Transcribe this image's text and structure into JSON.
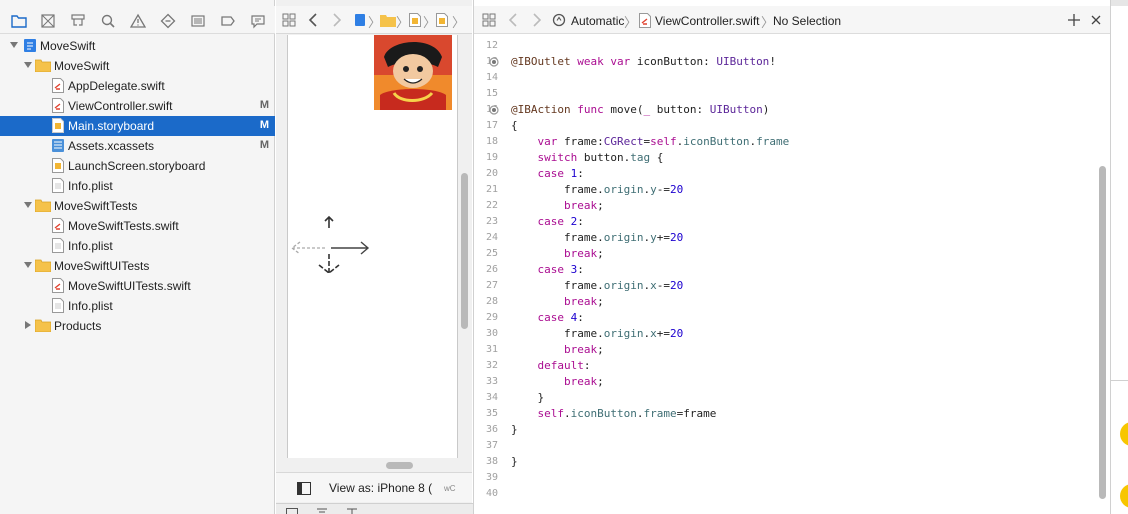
{
  "navigator": {
    "rows": [
      {
        "label": "MoveSwift",
        "badge": ""
      },
      {
        "label": "MoveSwift",
        "badge": ""
      },
      {
        "label": "AppDelegate.swift",
        "badge": ""
      },
      {
        "label": "ViewController.swift",
        "badge": "M"
      },
      {
        "label": "Main.storyboard",
        "badge": "M"
      },
      {
        "label": "Assets.xcassets",
        "badge": "M"
      },
      {
        "label": "LaunchScreen.storyboard",
        "badge": ""
      },
      {
        "label": "Info.plist",
        "badge": ""
      },
      {
        "label": "MoveSwiftTests",
        "badge": ""
      },
      {
        "label": "MoveSwiftTests.swift",
        "badge": ""
      },
      {
        "label": "Info.plist",
        "badge": ""
      },
      {
        "label": "MoveSwiftUITests",
        "badge": ""
      },
      {
        "label": "MoveSwiftUITests.swift",
        "badge": ""
      },
      {
        "label": "Info.plist",
        "badge": ""
      },
      {
        "label": "Products",
        "badge": ""
      }
    ]
  },
  "canvas": {
    "view_as": "View as: iPhone 8 (",
    "size_class": "wC",
    "trailing": "h"
  },
  "editor": {
    "jumpbar": {
      "mode": "Automatic",
      "file": "ViewController.swift",
      "selection": "No Selection"
    },
    "lines": [
      {
        "n": "12",
        "t": ""
      },
      {
        "n": "13",
        "t": "@IBOutlet weak var iconButton: UIButton!"
      },
      {
        "n": "14",
        "t": ""
      },
      {
        "n": "15",
        "t": ""
      },
      {
        "n": "16",
        "t": "@IBAction func move(_ button: UIButton)"
      },
      {
        "n": "17",
        "t": "{"
      },
      {
        "n": "18",
        "t": "    var frame:CGRect=self.iconButton.frame"
      },
      {
        "n": "19",
        "t": "    switch button.tag {"
      },
      {
        "n": "20",
        "t": "    case 1:"
      },
      {
        "n": "21",
        "t": "        frame.origin.y-=20"
      },
      {
        "n": "22",
        "t": "        break;"
      },
      {
        "n": "23",
        "t": "    case 2:"
      },
      {
        "n": "24",
        "t": "        frame.origin.y+=20"
      },
      {
        "n": "25",
        "t": "        break;"
      },
      {
        "n": "26",
        "t": "    case 3:"
      },
      {
        "n": "27",
        "t": "        frame.origin.x-=20"
      },
      {
        "n": "28",
        "t": "        break;"
      },
      {
        "n": "29",
        "t": "    case 4:"
      },
      {
        "n": "30",
        "t": "        frame.origin.x+=20"
      },
      {
        "n": "31",
        "t": "        break;"
      },
      {
        "n": "32",
        "t": "    default:"
      },
      {
        "n": "33",
        "t": "        break;"
      },
      {
        "n": "34",
        "t": "    }"
      },
      {
        "n": "35",
        "t": "    self.iconButton.frame=frame"
      },
      {
        "n": "36",
        "t": "}"
      },
      {
        "n": "37",
        "t": ""
      },
      {
        "n": "38",
        "t": "}"
      },
      {
        "n": "39",
        "t": ""
      },
      {
        "n": "40",
        "t": ""
      }
    ]
  },
  "colors": {
    "selection": "#1b6ac9",
    "folder": "#f5c24a",
    "keyword": "#aa0d91",
    "type": "#5c2699",
    "number": "#1c00cf",
    "accent_circle": "#f7c600"
  }
}
